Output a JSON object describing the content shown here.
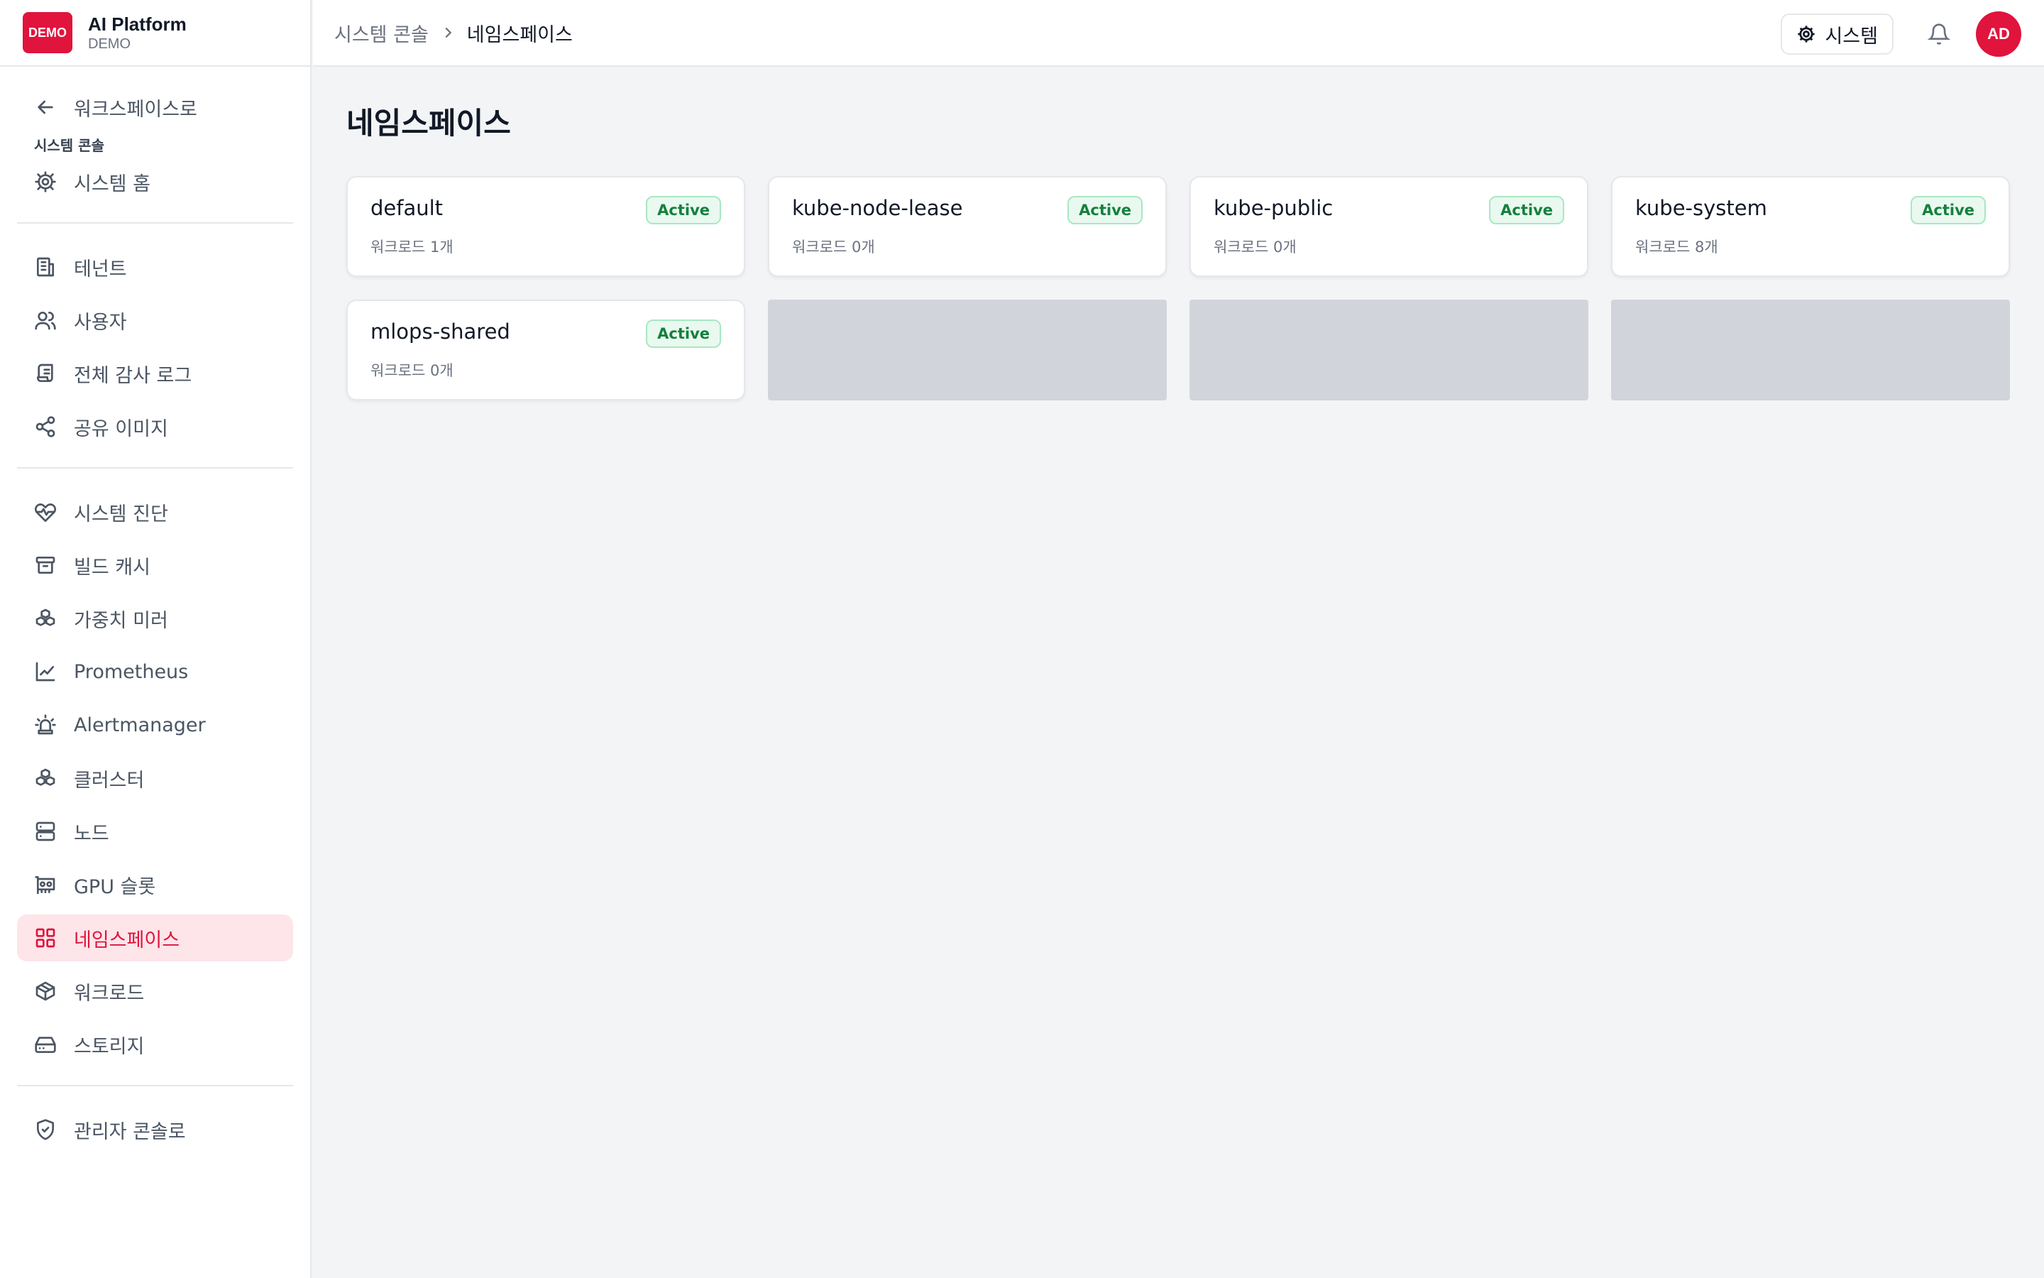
{
  "brand": {
    "logo_text": "DEMO",
    "name": "AI Platform",
    "sub": "DEMO"
  },
  "sidebar": {
    "back": {
      "label": "워크스페이스로",
      "icon": "arrow-left-icon"
    },
    "section_label": "시스템 콘솔",
    "home": {
      "label": "시스템 홈",
      "icon": "gear-icon"
    },
    "group1": [
      {
        "label": "테넌트",
        "icon": "building-icon"
      },
      {
        "label": "사용자",
        "icon": "users-icon"
      },
      {
        "label": "전체 감사 로그",
        "icon": "scroll-icon"
      },
      {
        "label": "공유 이미지",
        "icon": "share-icon"
      }
    ],
    "group2": [
      {
        "label": "시스템 진단",
        "icon": "heart-pulse-icon"
      },
      {
        "label": "빌드 캐시",
        "icon": "archive-icon"
      },
      {
        "label": "가중치 미러",
        "icon": "boxes-icon"
      },
      {
        "label": "Prometheus",
        "icon": "line-chart-icon"
      },
      {
        "label": "Alertmanager",
        "icon": "siren-icon"
      },
      {
        "label": "클러스터",
        "icon": "boxes-icon"
      },
      {
        "label": "노드",
        "icon": "server-icon"
      },
      {
        "label": "GPU 슬롯",
        "icon": "gpu-icon"
      },
      {
        "label": "네임스페이스",
        "icon": "grid-icon",
        "active": true
      },
      {
        "label": "워크로드",
        "icon": "package-icon"
      },
      {
        "label": "스토리지",
        "icon": "hard-drive-icon"
      }
    ],
    "admin": {
      "label": "관리자 콘솔로",
      "icon": "shield-check-icon"
    }
  },
  "header": {
    "breadcrumb": [
      "시스템 콘솔",
      "네임스페이스"
    ],
    "system_button": "시스템",
    "avatar": "AD"
  },
  "page": {
    "title": "네임스페이스",
    "namespaces": [
      {
        "name": "default",
        "status": "Active",
        "workloads": "워크로드 1개"
      },
      {
        "name": "kube-node-lease",
        "status": "Active",
        "workloads": "워크로드 0개"
      },
      {
        "name": "kube-public",
        "status": "Active",
        "workloads": "워크로드 0개"
      },
      {
        "name": "kube-system",
        "status": "Active",
        "workloads": "워크로드 8개"
      },
      {
        "name": "mlops-shared",
        "status": "Active",
        "workloads": "워크로드 0개"
      }
    ],
    "loading_placeholders": 3
  },
  "colors": {
    "accent": "#e0143c",
    "active_bg": "#fde5ea",
    "badge_green": "#15803d",
    "badge_bg": "#e9f9ef"
  }
}
